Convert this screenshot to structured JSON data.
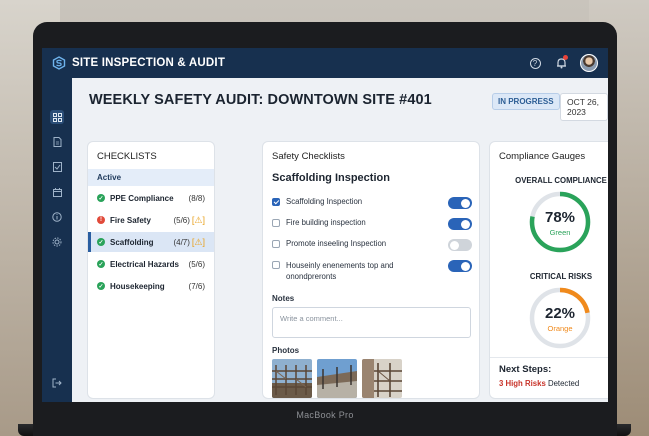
{
  "app": {
    "title": "SITE INSPECTION & AUDIT"
  },
  "header": {
    "page_title": "WEEKLY SAFETY AUDIT: DOWNTOWN SITE #401",
    "status": "IN PROGRESS",
    "date": "OCT 26, 2023"
  },
  "checklists": {
    "heading": "CHECKLISTS",
    "group": "Active",
    "items": [
      {
        "name": "PPE Compliance",
        "count": "(8/8)",
        "state": "ok"
      },
      {
        "name": "Fire Safety",
        "count": "(5/6)",
        "state": "warn"
      },
      {
        "name": "Scaffolding",
        "count": "(4/7)",
        "state": "ok"
      },
      {
        "name": "Electrical Hazards",
        "count": "(5/6)",
        "state": "ok"
      },
      {
        "name": "Housekeeping",
        "count": "(7/6)",
        "state": "ok"
      }
    ]
  },
  "safety": {
    "heading": "Safety Checklists",
    "section_title": "Scaffolding Inspection",
    "items": [
      {
        "label": "Scaffolding Inspection",
        "checked": true,
        "toggle": "on"
      },
      {
        "label": "Fire building inspection",
        "checked": false,
        "toggle": "on"
      },
      {
        "label": "Promote inseeling Inspection",
        "checked": false,
        "toggle": "off"
      },
      {
        "label": "Houseinly enenements top and onondpreronts",
        "checked": false,
        "toggle": "on"
      }
    ],
    "notes_label": "Notes",
    "notes_placeholder": "Write a comment...",
    "photos_label": "Photos"
  },
  "gauges": {
    "heading": "Compliance Gauges",
    "overall": {
      "label": "OVERALL COMPLIANCE",
      "value": "78%",
      "fraction": 0.78,
      "sub": "Green",
      "color": "#2aa35a"
    },
    "risks": {
      "label": "CRITICAL RISKS",
      "value": "22%",
      "fraction": 0.22,
      "sub": "Orange",
      "color": "#f08a1c"
    },
    "next_title": "Next Steps:",
    "next_highlight": "3 High Risks",
    "next_rest": " Detected"
  },
  "device": {
    "label": "MacBook Pro"
  }
}
